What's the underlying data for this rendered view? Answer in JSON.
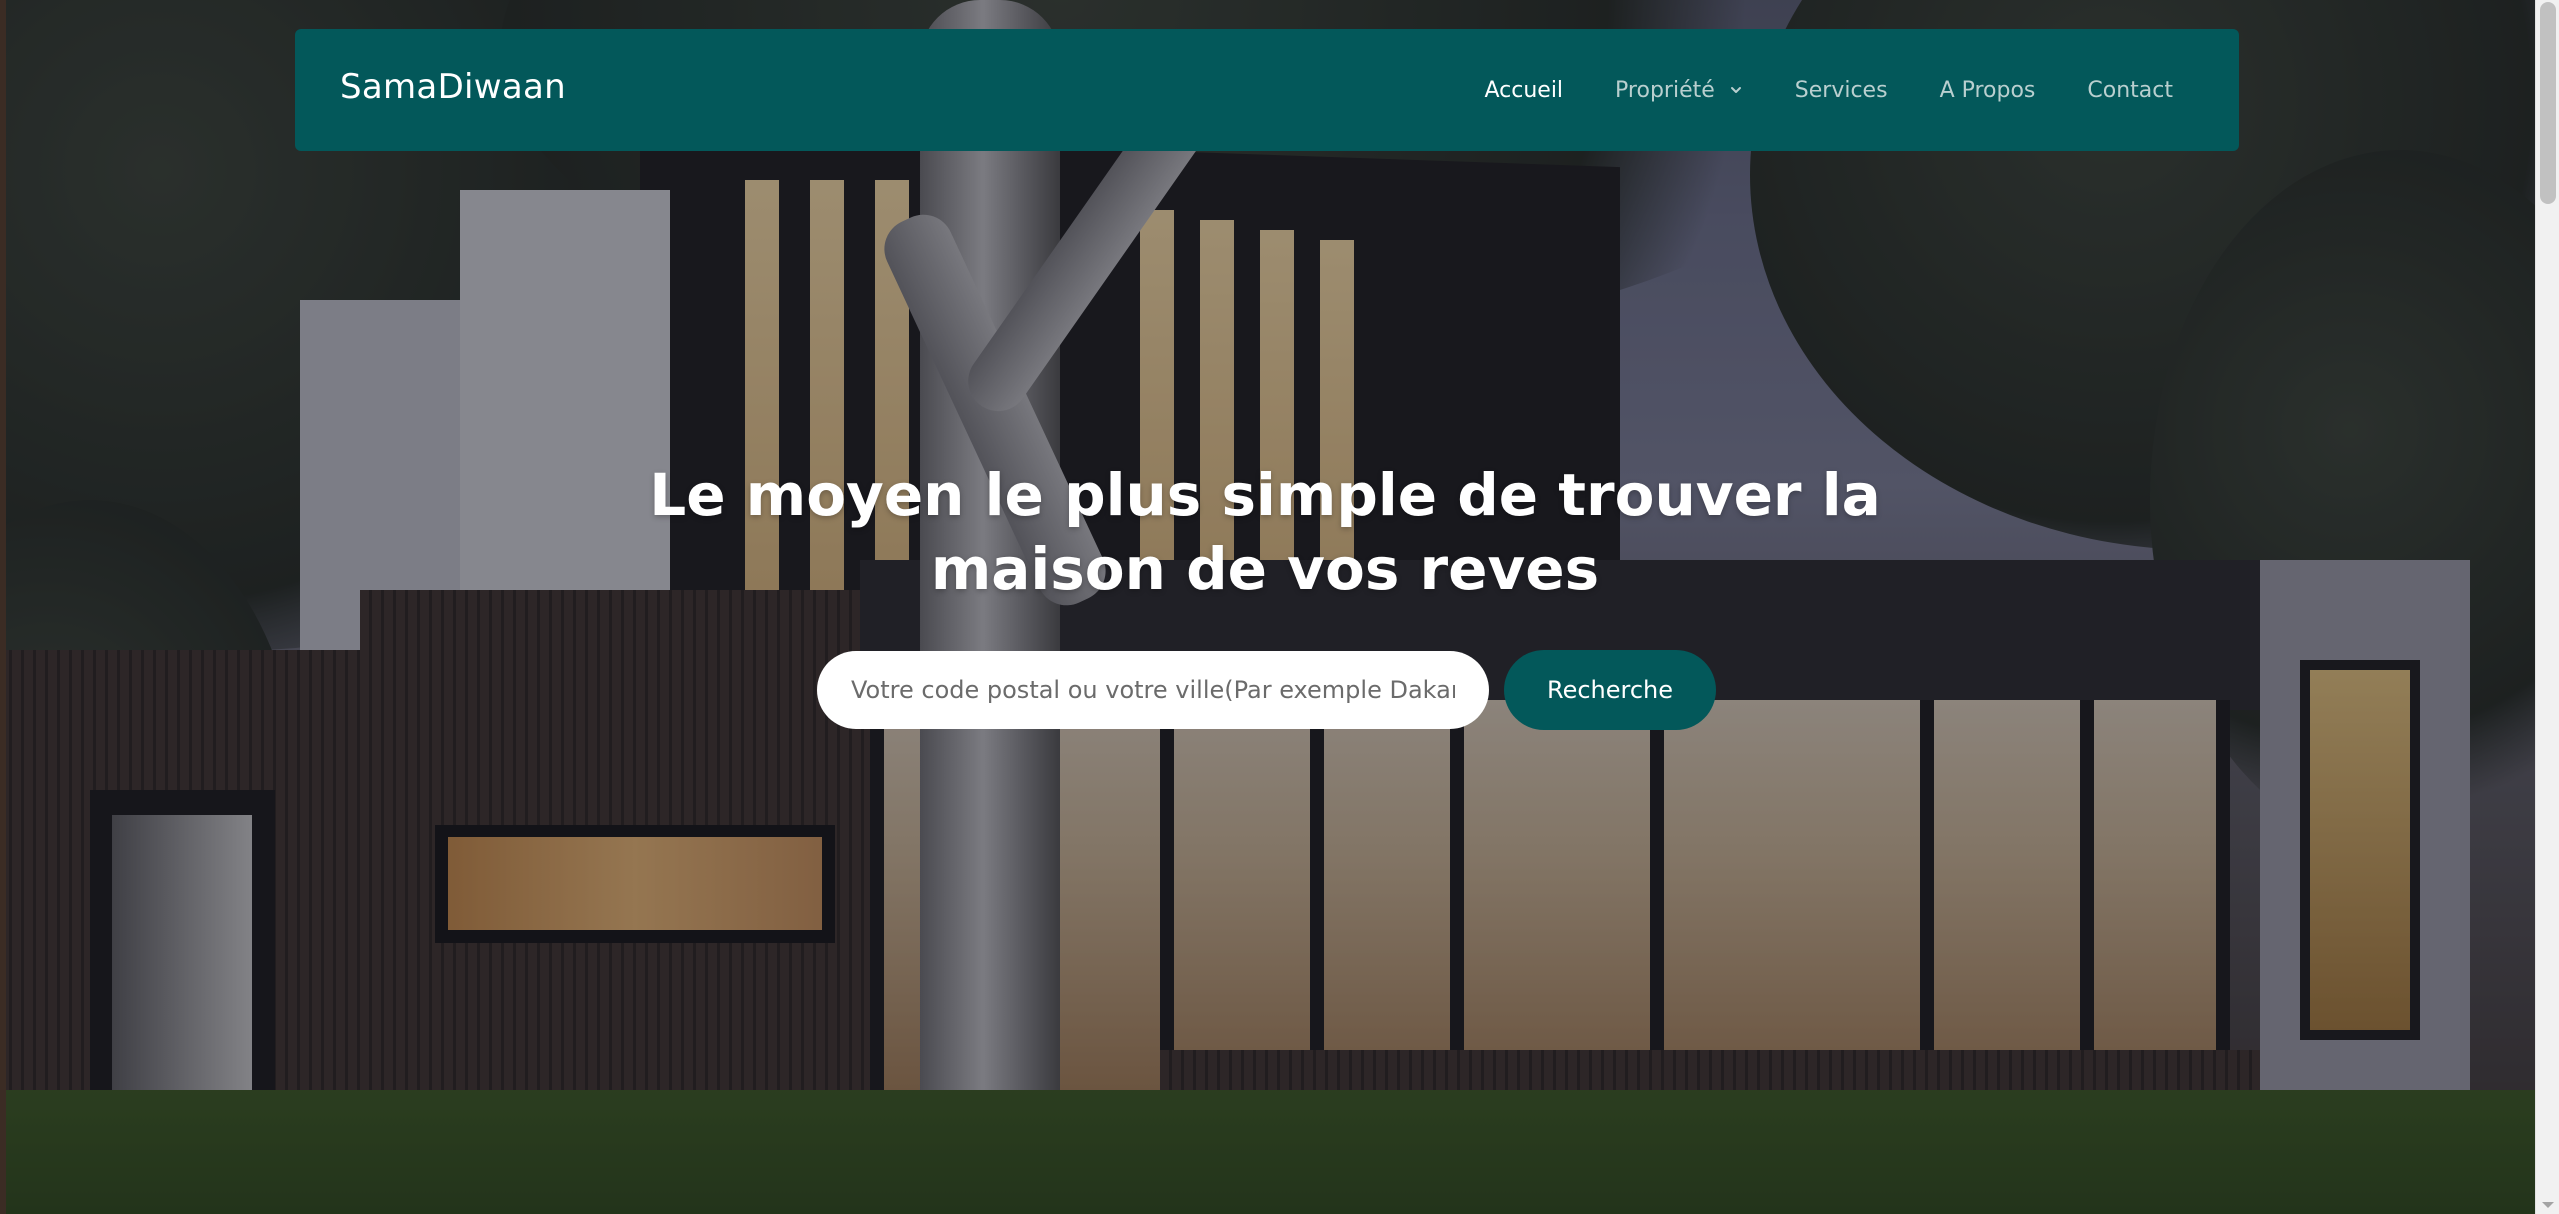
{
  "brand": {
    "name": "SamaDiwaan"
  },
  "nav": {
    "items": [
      {
        "label": "Accueil",
        "active": true
      },
      {
        "label": "Propriété",
        "has_dropdown": true
      },
      {
        "label": "Services"
      },
      {
        "label": "A Propos"
      },
      {
        "label": "Contact"
      }
    ]
  },
  "hero": {
    "title": "Le moyen le plus simple de trouver la maison de vos reves",
    "search": {
      "placeholder": "Votre code postal ou votre ville(Par exemple Dakar)",
      "value": "",
      "button_label": "Recherche"
    }
  },
  "colors": {
    "brand_teal": "#03585a",
    "nav_text": "#b9cfcf",
    "nav_active": "#ffffff"
  },
  "icons": {
    "dropdown": "chevron-down-icon"
  }
}
